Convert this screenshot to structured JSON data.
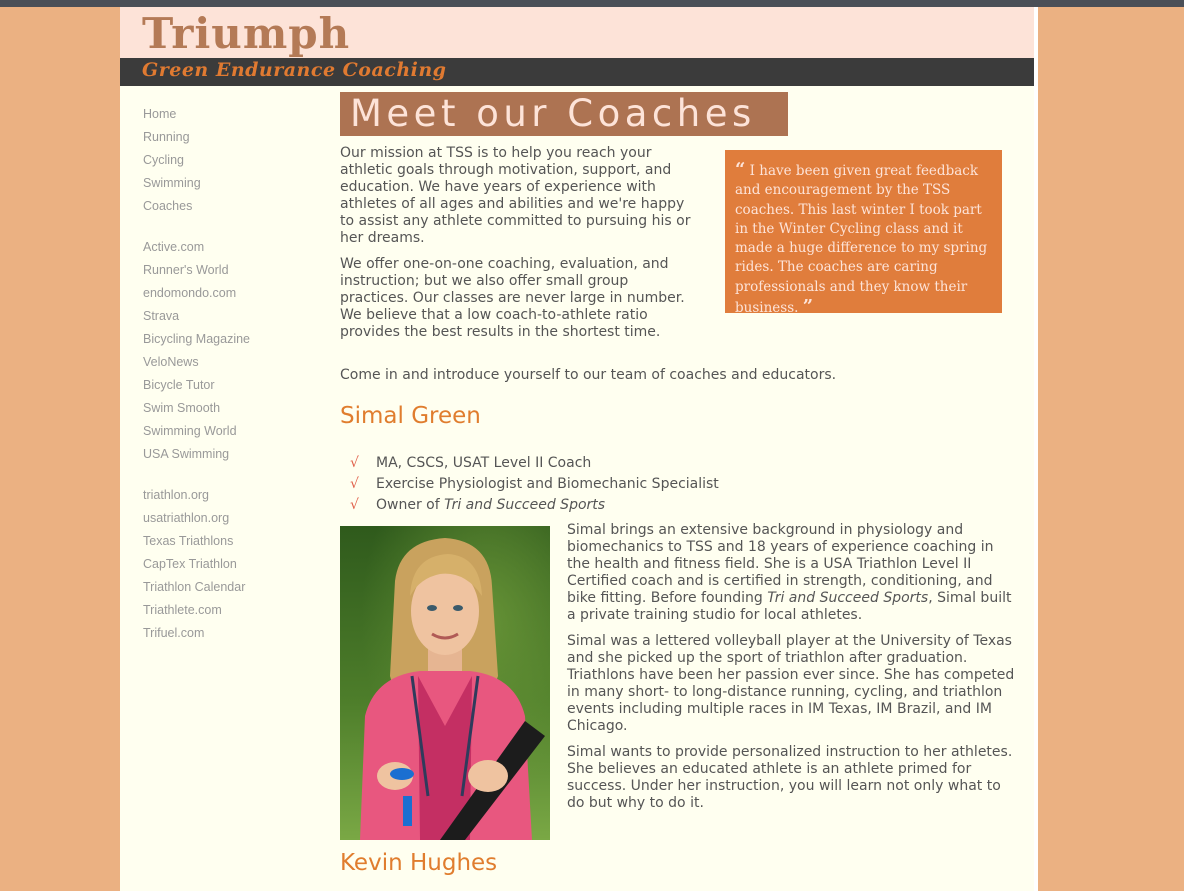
{
  "colors": {
    "background": "#ebb182",
    "page": "#fffff0",
    "header_top": "#fde3d8",
    "header_bar": "#3b3b3b",
    "logo_main": "#b47a56",
    "logo_sub": "#e07a31",
    "title_box": "#ad7352",
    "quote_box": "#e07d3c",
    "heading": "#e07d2e",
    "link": "#999999"
  },
  "header": {
    "logo": "Triumph",
    "tagline": "Green Endurance Coaching"
  },
  "sidebar": {
    "groups": [
      {
        "items": [
          {
            "label": "Home"
          },
          {
            "label": "Running"
          },
          {
            "label": "Cycling"
          },
          {
            "label": "Swimming"
          },
          {
            "label": "Coaches"
          }
        ]
      },
      {
        "items": [
          {
            "label": "Active.com"
          },
          {
            "label": "Runner's World"
          },
          {
            "label": "endomondo.com"
          },
          {
            "label": "Strava"
          },
          {
            "label": "Bicycling Magazine"
          },
          {
            "label": "VeloNews"
          },
          {
            "label": "Bicycle Tutor"
          },
          {
            "label": "Swim Smooth"
          },
          {
            "label": "Swimming World"
          },
          {
            "label": "USA Swimming"
          }
        ]
      },
      {
        "items": [
          {
            "label": "triathlon.org"
          },
          {
            "label": "usatriathlon.org"
          },
          {
            "label": "Texas Triathlons"
          },
          {
            "label": "CapTex Triathlon"
          },
          {
            "label": "Triathlon Calendar"
          },
          {
            "label": "Triathlete.com"
          },
          {
            "label": "Trifuel.com"
          }
        ]
      }
    ]
  },
  "main": {
    "title": "Meet our Coaches",
    "intro1": "Our mission at TSS is to help you reach your athletic goals through motivation, support, and education. We have years of experience with athletes of all ages and abilities and we're happy to assist any athlete committed to pursuing his or her dreams.",
    "intro2": "We offer one-on-one coaching, evaluation, and instruction; but we also offer small group practices. Our classes are never large in number. We believe that a low coach-to-athlete ratio provides the best results in the shortest time.",
    "intro3": "Come in and introduce yourself to our team of coaches and educators.",
    "quote": {
      "open_mark": "“",
      "text": "I have been given great feedback and encouragement by the TSS coaches. This last winter I took part in the Winter Cycling class and it made a huge difference to my spring rides. The coaches are caring professionals and they know their business.",
      "close_mark": "”"
    }
  },
  "coaches": [
    {
      "name": "Simal Green",
      "check": "√",
      "credentials": [
        "MA, CSCS, USAT Level II Coach",
        "Exercise Physiologist and Biomechanic Specialist"
      ],
      "credential3_prefix": "Owner of ",
      "credential3_business": "Tri and Succeed Sports",
      "bio1_a": "Simal brings an extensive background in physiology and biomechanics to TSS and 18 years of experience coaching in the health and fitness field. She is a USA Triathlon Level II Certified coach and is certified in strength, conditioning, and bike fitting. Before founding ",
      "bio1_business": "Tri and Succeed Sports",
      "bio1_b": ", Simal built a private training studio for local athletes.",
      "bio2": "Simal was a lettered volleyball player at the University of Texas and she picked up the sport of triathlon after graduation. Triathlons have been her passion ever since. She has competed in many short- to long-distance running, cycling, and triathlon events including multiple races in IM Texas, IM Brazil, and IM Chicago.",
      "bio3": "Simal wants to provide personalized instruction to her athletes. She believes an educated athlete is an athlete primed for success. Under her instruction, you will learn not only what to do but why to do it."
    },
    {
      "name": "Kevin Hughes"
    }
  ]
}
